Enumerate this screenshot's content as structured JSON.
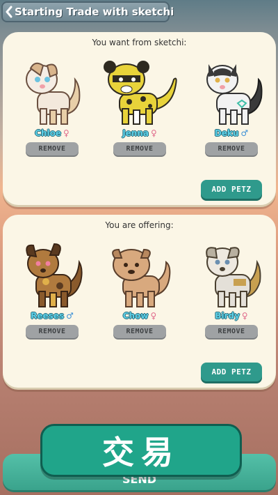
{
  "header": {
    "title": "Starting Trade with sketchi",
    "back_icon": "chevron-left-icon"
  },
  "want_panel": {
    "heading": "You want from sketchi:",
    "pets": [
      {
        "name": "Chloe",
        "gender": "♀",
        "gender_type": "female"
      },
      {
        "name": "Jenna",
        "gender": "♀",
        "gender_type": "female"
      },
      {
        "name": "Deku",
        "gender": "♂",
        "gender_type": "male"
      }
    ],
    "remove_label": "REMOVE",
    "add_label": "ADD PETZ"
  },
  "offer_panel": {
    "heading": "You are offering:",
    "pets": [
      {
        "name": "Reeses",
        "gender": "♂",
        "gender_type": "male"
      },
      {
        "name": "Chow",
        "gender": "♀",
        "gender_type": "female"
      },
      {
        "name": "Birdy",
        "gender": "♀",
        "gender_type": "female"
      }
    ],
    "remove_label": "REMOVE",
    "add_label": "ADD PETZ"
  },
  "send_label": "SEND",
  "overlay_text": "交易",
  "colors": {
    "accent": "#2f9a8c",
    "pet_name": "#5ccfe6",
    "panel": "#fbf6e6",
    "remove": "#9fa2a4"
  }
}
